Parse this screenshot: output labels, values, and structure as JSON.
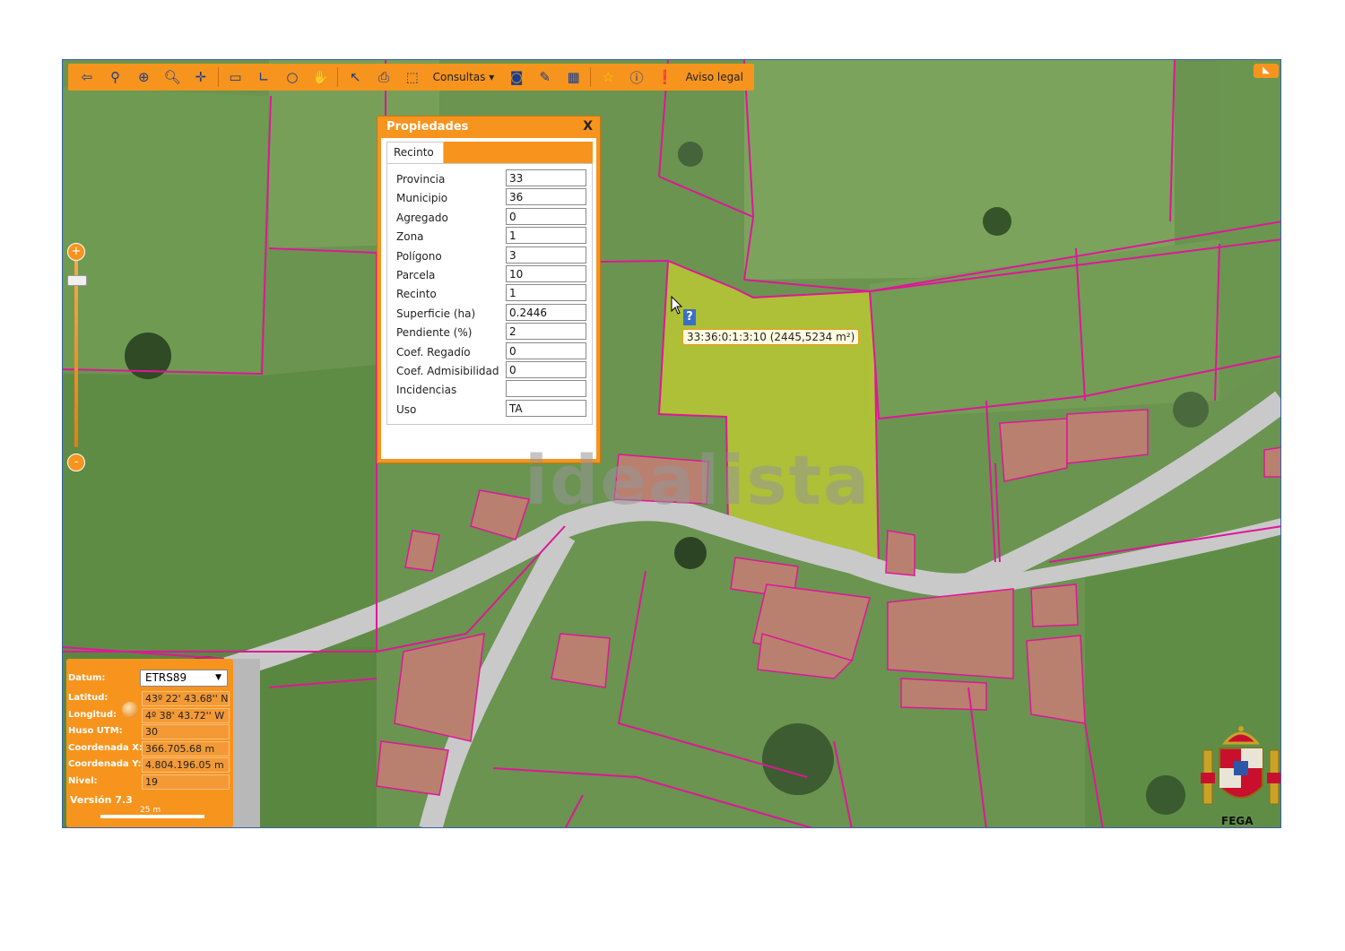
{
  "toolbar": {
    "consultas_label": "Consultas",
    "aviso_legal_label": "Aviso legal"
  },
  "properties_panel": {
    "title": "Propiedades",
    "close_label": "X",
    "tab_label": "Recinto",
    "fields": [
      {
        "label": "Provincia",
        "value": "33"
      },
      {
        "label": "Municipio",
        "value": "36"
      },
      {
        "label": "Agregado",
        "value": "0"
      },
      {
        "label": "Zona",
        "value": "1"
      },
      {
        "label": "Polígono",
        "value": "3"
      },
      {
        "label": "Parcela",
        "value": "10"
      },
      {
        "label": "Recinto",
        "value": "1"
      },
      {
        "label": "Superficie (ha)",
        "value": "0.2446"
      },
      {
        "label": "Pendiente (%)",
        "value": "2"
      },
      {
        "label": "Coef. Regadío",
        "value": "0"
      },
      {
        "label": "Coef. Admisibilidad",
        "value": "0"
      },
      {
        "label": "Incidencias",
        "value": ""
      },
      {
        "label": "Uso",
        "value": "TA"
      }
    ]
  },
  "tooltip": {
    "text": "33:36:0:1:3:10 (2445,5234 m²)",
    "help_mark": "?"
  },
  "watermark": "idealista",
  "zoom": {
    "plus": "+",
    "minus": "-"
  },
  "info_panel": {
    "datum_label": "Datum:",
    "datum_value": "ETRS89",
    "rows": [
      {
        "label": "Latitud:",
        "value": "43º 22' 43.68'' N"
      },
      {
        "label": "Longitud:",
        "value": "4º 38' 43.72'' W"
      },
      {
        "label": "Huso UTM:",
        "value": "30"
      },
      {
        "label": "Coordenada X:",
        "value": "366.705.68 m"
      },
      {
        "label": "Coordenada Y:",
        "value": "4.804.196.05 m"
      },
      {
        "label": "Nivel:",
        "value": "19"
      }
    ],
    "version": "Versión 7.3",
    "scale_label": "25 m"
  },
  "logo": {
    "label": "FEGA"
  },
  "colors": {
    "accent": "#f7941d",
    "parcel_border": "#e0169a",
    "selected_parcel": "#b8c832"
  }
}
